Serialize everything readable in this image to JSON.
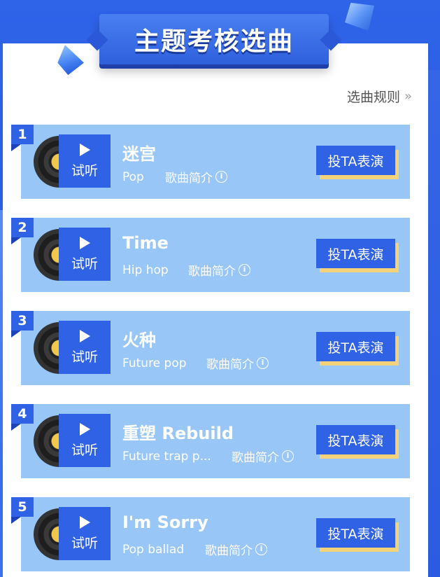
{
  "header": {
    "title": "主题考核选曲",
    "rules_label": "选曲规则",
    "rules_chevron": "»"
  },
  "colors": {
    "background": "#2f63e8",
    "card": "#98c6f6",
    "accent": "#2f62e4",
    "button_shadow": "#f3d27a"
  },
  "icons": [
    "play-icon",
    "info-icon",
    "vinyl-record-icon",
    "chevron-right-double-icon"
  ],
  "songs": [
    {
      "rank": "1",
      "title": "迷宫",
      "genre": "Pop",
      "intro_label": "歌曲简介",
      "listen_label": "试听",
      "vote_label": "投TA表演"
    },
    {
      "rank": "2",
      "title": "Time",
      "genre": "Hip hop",
      "intro_label": "歌曲简介",
      "listen_label": "试听",
      "vote_label": "投TA表演"
    },
    {
      "rank": "3",
      "title": "火种",
      "genre": "Future pop",
      "intro_label": "歌曲简介",
      "listen_label": "试听",
      "vote_label": "投TA表演"
    },
    {
      "rank": "4",
      "title": "重塑 Rebuild",
      "genre": "Future trap p...",
      "intro_label": "歌曲简介",
      "listen_label": "试听",
      "vote_label": "投TA表演"
    },
    {
      "rank": "5",
      "title": "I'm Sorry",
      "genre": "Pop ballad",
      "intro_label": "歌曲简介",
      "listen_label": "试听",
      "vote_label": "投TA表演"
    }
  ]
}
